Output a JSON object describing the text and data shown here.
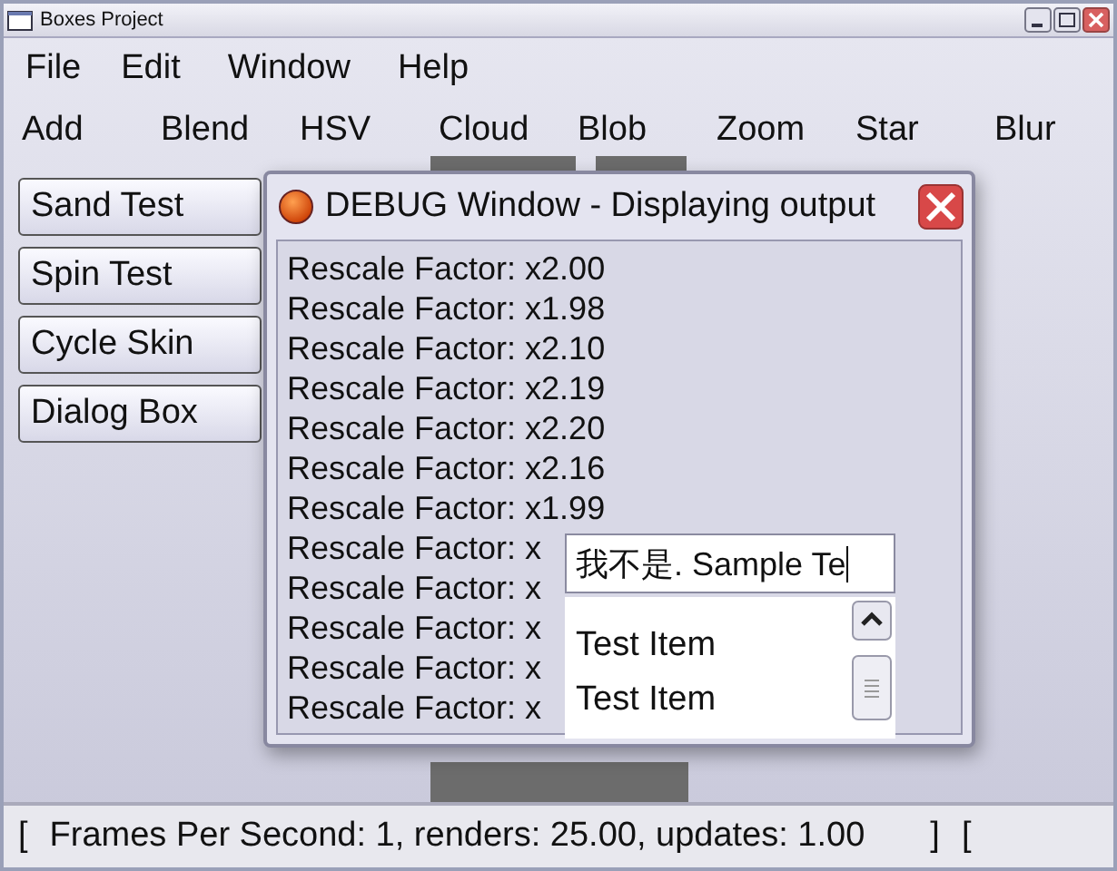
{
  "window": {
    "title": "Boxes Project"
  },
  "menu": [
    "File",
    "Edit",
    "Window",
    "Help"
  ],
  "toolbar": [
    "Add",
    "Blend",
    "HSV",
    "Cloud",
    "Blob",
    "Zoom",
    "Star",
    "Blur"
  ],
  "side_buttons": [
    "Sand Test",
    "Spin Test",
    "Cycle Skin",
    "Dialog Box"
  ],
  "debug_window": {
    "title": "DEBUG Window - Displaying output",
    "lines": [
      "Rescale Factor: x2.00",
      "Rescale Factor: x1.98",
      "Rescale Factor: x2.10",
      "Rescale Factor: x2.19",
      "Rescale Factor: x2.20",
      "Rescale Factor: x2.16",
      "Rescale Factor: x1.99",
      "Rescale Factor: x",
      "Rescale Factor: x",
      "Rescale Factor: x",
      "Rescale Factor: x",
      "Rescale Factor: x"
    ],
    "input": {
      "value": "我不是. Sample Te"
    },
    "list": {
      "items": [
        "Test Item",
        "Test Item"
      ]
    }
  },
  "status_bar": {
    "open_bracket": "[",
    "text": "Frames Per Second: 1, renders: 25.00, updates: 1.00",
    "close_bracket": "]",
    "trailing": "["
  }
}
